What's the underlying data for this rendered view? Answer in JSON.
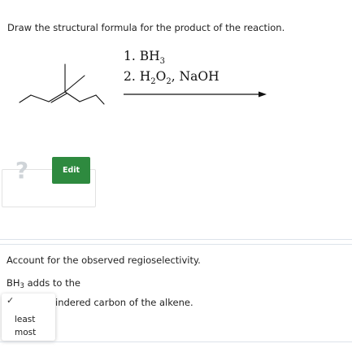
{
  "question1": {
    "prompt": "Draw the structural formula for the product of the reaction."
  },
  "reaction": {
    "step1": "1. BH",
    "step1_sub": "3",
    "step2_a": "2. H",
    "step2_sub1": "2",
    "step2_b": "O",
    "step2_sub2": "2",
    "step2_c": ", NaOH"
  },
  "answer_widget": {
    "question_mark": "?",
    "edit_label": "Edit"
  },
  "question2": {
    "prompt": "Account for the observed regioselectivity.",
    "sentence_part1": "BH",
    "sentence_sub": "3",
    "sentence_part2": " adds to the",
    "sentence_part3": "indered carbon of the alkene.",
    "check": "✓",
    "options": [
      "least",
      "most"
    ]
  },
  "colors": {
    "accent_green": "#2e8a3f",
    "divider": "#dde3ea"
  }
}
